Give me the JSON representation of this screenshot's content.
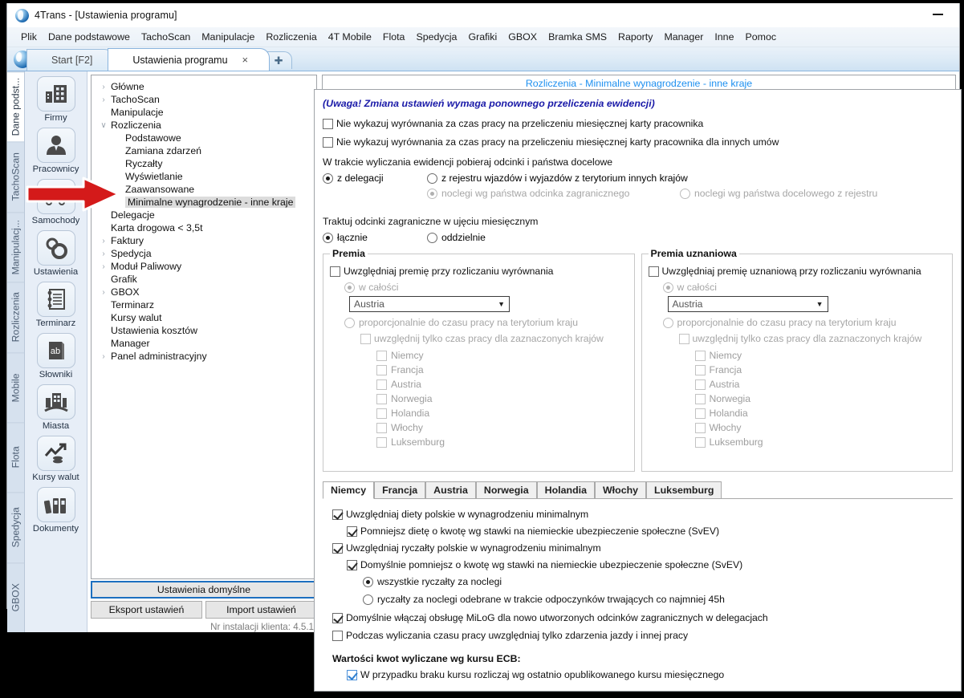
{
  "window": {
    "title": "4Trans - [Ustawienia programu]",
    "logo_icon": "4trans-logo-icon",
    "minimize_icon": "minimize-icon"
  },
  "menubar": {
    "items": [
      "Plik",
      "Dane podstawowe",
      "TachoScan",
      "Manipulacje",
      "Rozliczenia",
      "4T Mobile",
      "Flota",
      "Spedycja",
      "Grafiki",
      "GBOX",
      "Bramka SMS",
      "Raporty",
      "Manager",
      "Inne",
      "Pomoc"
    ]
  },
  "tabstrip": {
    "tabs": [
      {
        "label": "Start [F2]",
        "active": false,
        "closable": false
      },
      {
        "label": "Ustawienia programu",
        "active": true,
        "closable": true,
        "close_label": "×"
      }
    ],
    "add_tab_label": "✚"
  },
  "rail": {
    "items": [
      {
        "label": "Dane podst...",
        "active": true
      },
      {
        "label": "TachoScan",
        "active": false
      },
      {
        "label": "Manipulacj...",
        "active": false
      },
      {
        "label": "Rozliczenia",
        "active": false
      },
      {
        "label": "Mobile",
        "active": false
      },
      {
        "label": "Flota",
        "active": false
      },
      {
        "label": "Spedycja",
        "active": false
      },
      {
        "label": "GBOX",
        "active": false
      }
    ]
  },
  "iconcol": {
    "items": [
      {
        "label": "Firmy",
        "icon": "building-icon"
      },
      {
        "label": "Pracownicy",
        "icon": "person-icon"
      },
      {
        "label": "Samochody",
        "icon": "truck-icon"
      },
      {
        "label": "Ustawienia",
        "icon": "gears-icon"
      },
      {
        "label": "Terminarz",
        "icon": "notebook-icon"
      },
      {
        "label": "Słowniki",
        "icon": "dictionary-ab-icon"
      },
      {
        "label": "Miasta",
        "icon": "city-icon"
      },
      {
        "label": "Kursy walut",
        "icon": "exchange-rate-chart-icon"
      },
      {
        "label": "Dokumenty",
        "icon": "binders-icon"
      }
    ]
  },
  "tree": {
    "nodes": [
      {
        "label": "Główne",
        "level": 1,
        "chevron": "›",
        "selected": false
      },
      {
        "label": "TachoScan",
        "level": 1,
        "chevron": "›",
        "selected": false
      },
      {
        "label": "Manipulacje",
        "level": 1,
        "chevron": "",
        "selected": false
      },
      {
        "label": "Rozliczenia",
        "level": 1,
        "chevron": "∨",
        "selected": false
      },
      {
        "label": "Podstawowe",
        "level": 2,
        "chevron": "",
        "selected": false
      },
      {
        "label": "Zamiana zdarzeń",
        "level": 2,
        "chevron": "",
        "selected": false
      },
      {
        "label": "Ryczałty",
        "level": 2,
        "chevron": "",
        "selected": false
      },
      {
        "label": "Wyświetlanie",
        "level": 2,
        "chevron": "",
        "selected": false
      },
      {
        "label": "Zaawansowane",
        "level": 2,
        "chevron": "",
        "selected": false
      },
      {
        "label": "Minimalne wynagrodzenie - inne kraje",
        "level": 2,
        "chevron": "",
        "selected": true
      },
      {
        "label": "Delegacje",
        "level": 1,
        "chevron": "",
        "selected": false
      },
      {
        "label": "Karta drogowa < 3,5t",
        "level": 1,
        "chevron": "",
        "selected": false
      },
      {
        "label": "Faktury",
        "level": 1,
        "chevron": "›",
        "selected": false
      },
      {
        "label": "Spedycja",
        "level": 1,
        "chevron": "›",
        "selected": false
      },
      {
        "label": "Moduł Paliwowy",
        "level": 1,
        "chevron": "›",
        "selected": false
      },
      {
        "label": "Grafik",
        "level": 1,
        "chevron": "",
        "selected": false
      },
      {
        "label": "GBOX",
        "level": 1,
        "chevron": "›",
        "selected": false
      },
      {
        "label": "Terminarz",
        "level": 1,
        "chevron": "",
        "selected": false
      },
      {
        "label": "Kursy walut",
        "level": 1,
        "chevron": "",
        "selected": false
      },
      {
        "label": "Ustawienia kosztów",
        "level": 1,
        "chevron": "",
        "selected": false
      },
      {
        "label": "Manager",
        "level": 1,
        "chevron": "",
        "selected": false
      },
      {
        "label": "Panel administracyjny",
        "level": 1,
        "chevron": "›",
        "selected": false
      }
    ],
    "buttons": {
      "defaults": "Ustawienia domyślne",
      "export": "Eksport ustawień",
      "import": "Import ustawień"
    },
    "status": "Nr instalacji klienta: 4.5.1"
  },
  "panel": {
    "header": "Rozliczenia - Minimalne wynagrodzenie - inne kraje",
    "header_color": "#1e90f0",
    "warning": "(Uwaga! Zmiana ustawień wymaga ponownego przeliczenia ewidencji)",
    "warning_color": "#1a1aa8",
    "checkbox_1": {
      "label": "Nie wykazuj wyrównania za czas pracy na przeliczeniu miesięcznej karty pracownika",
      "checked": false
    },
    "checkbox_2": {
      "label": "Nie wykazuj wyrównania za czas pracy na przeliczeniu miesięcznej karty pracownika dla innych umów",
      "checked": false
    },
    "section_pobieraj": {
      "label": "W trakcie wyliczania ewidencji pobieraj odcinki i państwa docelowe",
      "radio_a": {
        "label": "z delegacji",
        "checked": true,
        "disabled": false
      },
      "radio_b": {
        "label": "z rejestru wjazdów i wyjazdów z terytorium innych krajów",
        "checked": false,
        "disabled": false
      },
      "radio_c": {
        "label": "noclegi wg państwa odcinka zagranicznego",
        "checked": true,
        "disabled": true
      },
      "radio_d": {
        "label": "noclegi wg państwa docelowego z rejestru",
        "checked": false,
        "disabled": true
      }
    },
    "section_traktuj": {
      "label": "Traktuj odcinki zagraniczne w ujęciu miesięcznym",
      "radio_a": {
        "label": "łącznie",
        "checked": true
      },
      "radio_b": {
        "label": "oddzielnie",
        "checked": false
      }
    },
    "group_premia": {
      "title": "Premia",
      "enable": {
        "label": "Uwzględniaj premię przy rozliczaniu wyrównania",
        "checked": false
      },
      "radio_whole": {
        "label": "w całości",
        "checked": true,
        "disabled": true
      },
      "combo_value": "Austria",
      "combo_arrow": "▼",
      "radio_prop": {
        "label": "proporcjonalnie do czasu pracy na terytorium kraju",
        "checked": false,
        "disabled": true
      },
      "only_selected": {
        "label": "uwzględnij tylko czas pracy dla zaznaczonych krajów",
        "checked": false,
        "disabled": true
      },
      "countries": [
        {
          "label": "Niemcy",
          "checked": false
        },
        {
          "label": "Francja",
          "checked": false
        },
        {
          "label": "Austria",
          "checked": false
        },
        {
          "label": "Norwegia",
          "checked": false
        },
        {
          "label": "Holandia",
          "checked": false
        },
        {
          "label": "Włochy",
          "checked": false
        },
        {
          "label": "Luksemburg",
          "checked": false
        }
      ]
    },
    "group_premia_uzn": {
      "title": "Premia uznaniowa",
      "enable": {
        "label": "Uwzględniaj premię uznaniową przy rozliczaniu wyrównania",
        "checked": false
      },
      "radio_whole": {
        "label": "w całości",
        "checked": true,
        "disabled": true
      },
      "combo_value": "Austria",
      "combo_arrow": "▼",
      "radio_prop": {
        "label": "proporcjonalnie do czasu pracy na terytorium kraju",
        "checked": false,
        "disabled": true
      },
      "only_selected": {
        "label": "uwzględnij tylko czas pracy dla zaznaczonych krajów",
        "checked": false,
        "disabled": true
      },
      "countries": [
        {
          "label": "Niemcy",
          "checked": false
        },
        {
          "label": "Francja",
          "checked": false
        },
        {
          "label": "Austria",
          "checked": false
        },
        {
          "label": "Norwegia",
          "checked": false
        },
        {
          "label": "Holandia",
          "checked": false
        },
        {
          "label": "Włochy",
          "checked": false
        },
        {
          "label": "Luksemburg",
          "checked": false
        }
      ]
    },
    "country_tabs": [
      {
        "label": "Niemcy",
        "active": true
      },
      {
        "label": "Francja",
        "active": false
      },
      {
        "label": "Austria",
        "active": false
      },
      {
        "label": "Norwegia",
        "active": false
      },
      {
        "label": "Holandia",
        "active": false
      },
      {
        "label": "Włochy",
        "active": false
      },
      {
        "label": "Luksemburg",
        "active": false
      }
    ],
    "tab_content": {
      "c1": {
        "label": "Uwzględniaj diety polskie w wynagrodzeniu minimalnym",
        "checked": true
      },
      "c2": {
        "label": "Pomniejsz dietę o kwotę wg stawki na niemieckie ubezpieczenie społeczne (SvEV)",
        "checked": true
      },
      "c3": {
        "label": "Uwzględniaj ryczałty polskie w wynagrodzeniu minimalnym",
        "checked": true
      },
      "c4": {
        "label": "Domyślnie pomniejsz o kwotę wg stawki na niemieckie ubezpieczenie społeczne (SvEV)",
        "checked": true
      },
      "r1": {
        "label": "wszystkie ryczałty za noclegi",
        "checked": true
      },
      "r2": {
        "label": "ryczałty za noclegi odebrane w trakcie odpoczynków trwających co najmniej 45h",
        "checked": false
      },
      "c5": {
        "label": "Domyślnie włączaj obsługę MiLoG dla nowo utworzonych odcinków zagranicznych w delegacjach",
        "checked": true
      },
      "c6": {
        "label": "Podczas wyliczania czasu pracy uwzględniaj tylko zdarzenia jazdy i innej pracy",
        "checked": false
      },
      "ecb_title": "Wartości kwot wyliczane wg kursu ECB:",
      "c7": {
        "label": "W przypadku braku kursu rozliczaj wg ostatnio opublikowanego kursu miesięcznego",
        "checked": true
      }
    }
  },
  "annotation": {
    "arrow_icon": "red-arrow-pointer-icon",
    "color": "#d41a1a"
  }
}
